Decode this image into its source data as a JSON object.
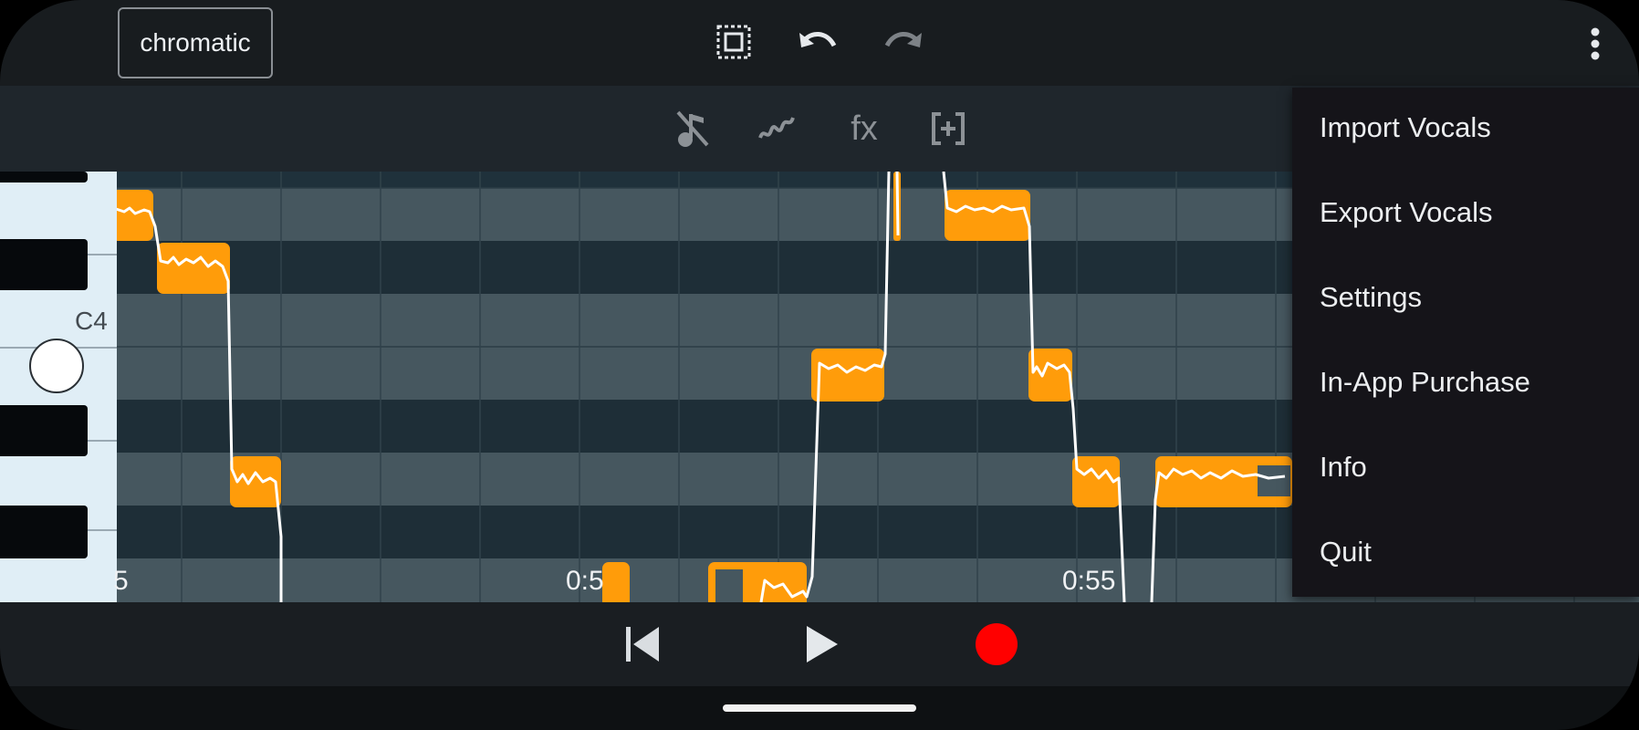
{
  "toolbar": {
    "scale_label": "chromatic",
    "icons": [
      "select-all-icon",
      "undo-icon",
      "redo-icon",
      "more-vert-icon"
    ]
  },
  "edit_tools": [
    "mute-note-icon",
    "pitch-curve-icon",
    "fx-icon",
    "add-selection-icon"
  ],
  "edit_tools_fx_label": "fx",
  "piano": {
    "c4_label": "C4"
  },
  "timeline": {
    "label_left": "5",
    "label_mid": "0:5",
    "label_right": "0:55"
  },
  "transport": {
    "icons": [
      "skip-back-icon",
      "play-icon",
      "record-icon"
    ],
    "record_color": "#ff0000"
  },
  "menu": {
    "items": [
      "Import Vocals",
      "Export Vocals",
      "Settings",
      "In-App Purchase",
      "Info",
      "Quit"
    ]
  },
  "colors": {
    "note": "#ff9c0a",
    "pitch_line": "#ffffff",
    "accent": "#ff9c0a"
  }
}
